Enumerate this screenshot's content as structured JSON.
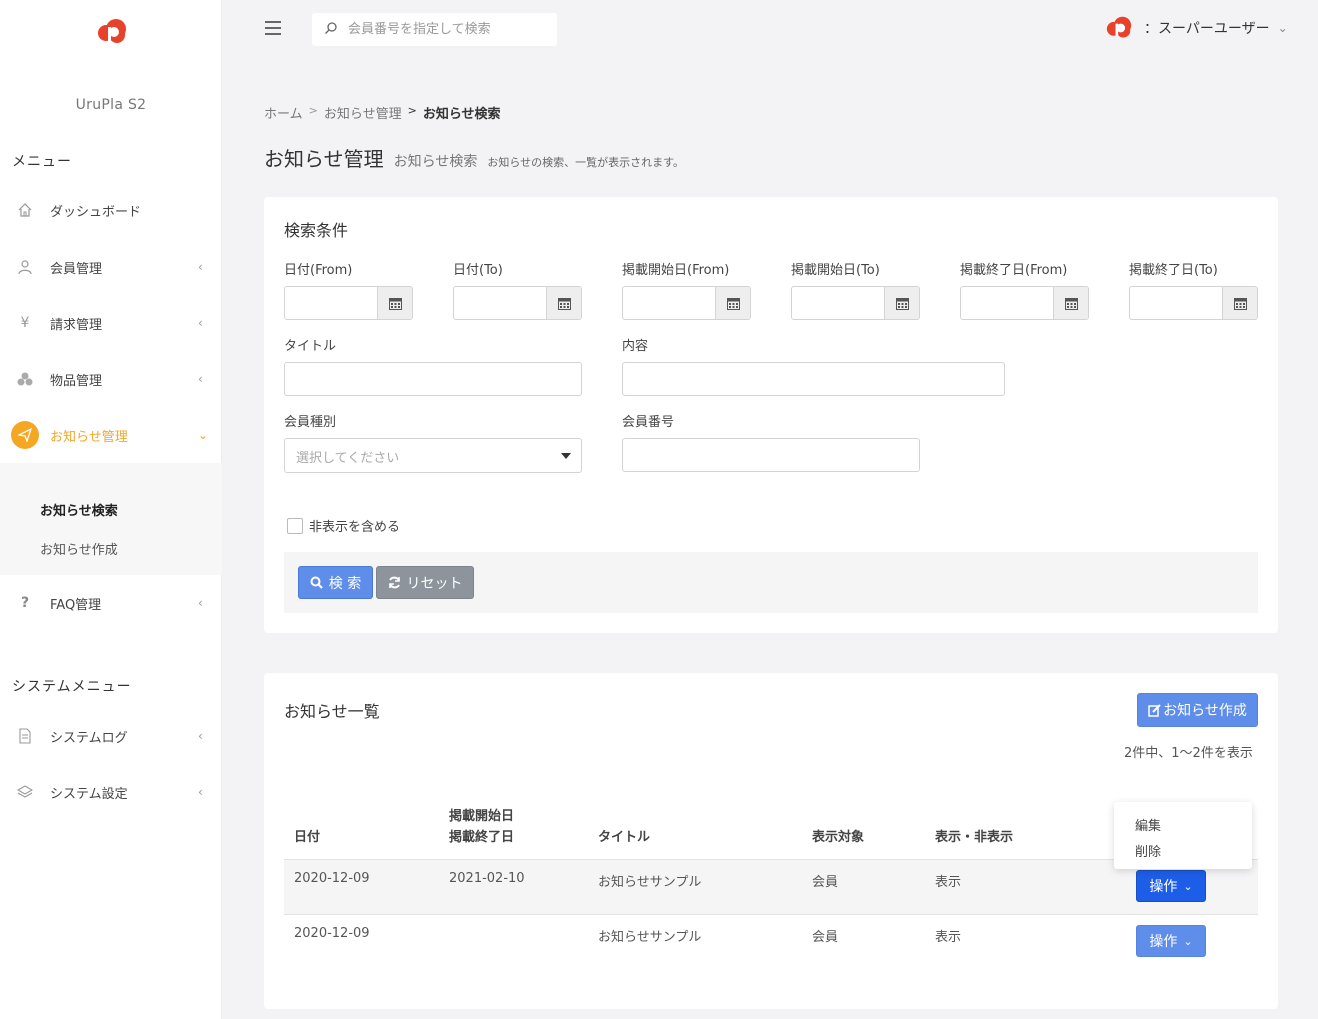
{
  "app": {
    "name": "UruPla S2"
  },
  "topbar": {
    "search_placeholder": "会員番号を指定して検索",
    "user_name": "：スーパーユーザー"
  },
  "sidebar": {
    "menu_heading": "メニュー",
    "items": [
      {
        "label": "ダッシュボード",
        "icon": "home-icon"
      },
      {
        "label": "会員管理",
        "icon": "user-icon"
      },
      {
        "label": "請求管理",
        "icon": "yen-icon"
      },
      {
        "label": "物品管理",
        "icon": "boxes-icon"
      },
      {
        "label": "お知らせ管理",
        "icon": "paper-plane-icon"
      },
      {
        "label": "FAQ管理",
        "icon": "question-icon"
      }
    ],
    "sub_items": [
      "お知らせ検索",
      "お知らせ作成"
    ],
    "system_heading": "システムメニュー",
    "system_items": [
      {
        "label": "システムログ",
        "icon": "document-icon"
      },
      {
        "label": "システム設定",
        "icon": "layers-icon"
      }
    ]
  },
  "breadcrumb": [
    "ホーム",
    "お知らせ管理",
    "お知らせ検索"
  ],
  "page": {
    "title": "お知らせ管理",
    "subtitle": "お知らせ検索",
    "description": "お知らせの検索、一覧が表示されます。"
  },
  "search": {
    "title": "検索条件",
    "date_fields": [
      "日付(From)",
      "日付(To)",
      "掲載開始日(From)",
      "掲載開始日(To)",
      "掲載終了日(From)",
      "掲載終了日(To)"
    ],
    "title_label": "タイトル",
    "content_label": "内容",
    "member_type_label": "会員種別",
    "member_type_placeholder": "選択してください",
    "member_no_label": "会員番号",
    "include_hidden_label": "非表示を含める",
    "search_button": "検 索",
    "reset_button": "リセット"
  },
  "list": {
    "title": "お知らせ一覧",
    "create_button": "お知らせ作成",
    "count_text": "2件中、1〜2件を表示",
    "headers": {
      "date": "日付",
      "start": "掲載開始日",
      "end": "掲載終了日",
      "title": "タイトル",
      "target": "表示対象",
      "visible": "表示・非表示"
    },
    "rows": [
      {
        "date": "2020-12-09",
        "start_end": "2021-02-10",
        "title": "お知らせサンプル",
        "target": "会員",
        "visible": "表示",
        "action": "操作"
      },
      {
        "date": "2020-12-09",
        "start_end": "",
        "title": "お知らせサンプル",
        "target": "会員",
        "visible": "表示",
        "action": "操作"
      }
    ],
    "dropdown": [
      "編集",
      "削除"
    ]
  },
  "colors": {
    "accent": "#f5a623",
    "primary": "#5f8dea",
    "primary_dark": "#1d5ee8",
    "secondary": "#8d949c",
    "logo_red": "#e8412c"
  }
}
